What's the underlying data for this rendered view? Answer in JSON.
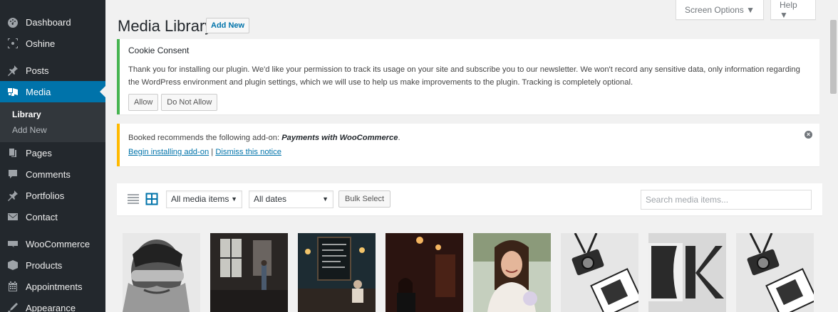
{
  "sidebar": {
    "items": [
      {
        "label": "Dashboard",
        "icon": "dashboard-icon"
      },
      {
        "label": "Oshine",
        "icon": "oshine-icon"
      },
      {
        "label": "Posts",
        "icon": "pin-icon"
      },
      {
        "label": "Media",
        "icon": "media-icon"
      },
      {
        "label": "Pages",
        "icon": "pages-icon"
      },
      {
        "label": "Comments",
        "icon": "comments-icon"
      },
      {
        "label": "Portfolios",
        "icon": "pin-icon"
      },
      {
        "label": "Contact",
        "icon": "mail-icon"
      },
      {
        "label": "WooCommerce",
        "icon": "woocommerce-icon"
      },
      {
        "label": "Products",
        "icon": "products-icon"
      },
      {
        "label": "Appointments",
        "icon": "calendar-icon"
      },
      {
        "label": "Appearance",
        "icon": "appearance-icon"
      }
    ],
    "media_submenu": [
      "Library",
      "Add New"
    ],
    "active_color": "#0073aa"
  },
  "header": {
    "screen_options": "Screen Options ▼",
    "help": "Help ▼",
    "title": "Media Library",
    "add_new": "Add New"
  },
  "cookie_notice": {
    "title": "Cookie Consent",
    "text": "Thank you for installing our plugin. We'd like your permission to track its usage on your site and subscribe you to our newsletter. We won't record any sensitive data, only information regarding the WordPress environment and plugin settings, which we will use to help us make improvements to the plugin. Tracking is completely optional.",
    "allow": "Allow",
    "deny": "Do Not Allow",
    "border_color": "#46b450"
  },
  "booked_notice": {
    "prefix": "Booked recommends the following add-on: ",
    "addon": "Payments with WooCommerce",
    "suffix": ".",
    "install_link": "Begin installing add-on",
    "separator": " | ",
    "dismiss_link": "Dismiss this notice",
    "border_color": "#ffb900"
  },
  "toolbar": {
    "filter_type": "All media items",
    "filter_date": "All dates",
    "bulk_select": "Bulk Select",
    "search_placeholder": "Search media items..."
  },
  "media_items": [
    "portrait-bw",
    "window-man",
    "cafe-interior",
    "woman-bar",
    "smiling-woman",
    "camera-prints",
    "letter-k",
    "camera-prints"
  ]
}
